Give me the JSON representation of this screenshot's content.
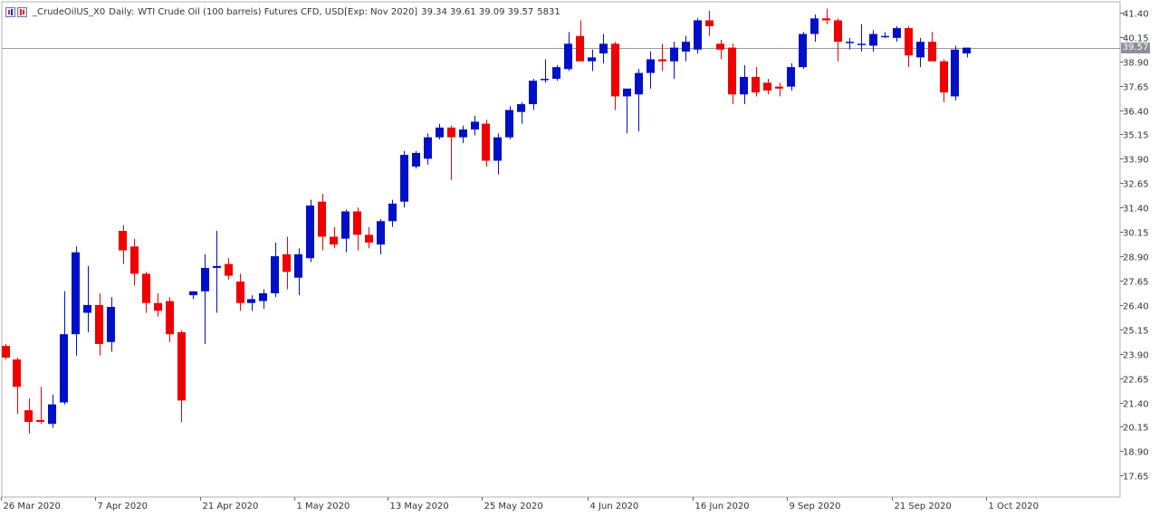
{
  "header": {
    "symbol": "_CrudeOilUS_X0",
    "timeframe": "Daily:",
    "description": "WTI Crude Oil (100 barrels) Futures CFD, USD[Exp: Nov 2020]",
    "ohlc": "39.34 39.61 39.09 39.57",
    "volume": "5831"
  },
  "current_price_label": "39.57",
  "colors": {
    "bull": "#0010C8",
    "bear": "#F00000",
    "grid": "#b0b0b0",
    "text": "#333333",
    "badge": "#8a9099"
  },
  "chart_data": {
    "type": "candlestick",
    "title": "",
    "y_ticks": [
      "41.40",
      "40.15",
      "38.90",
      "37.65",
      "36.40",
      "35.15",
      "33.90",
      "32.65",
      "31.40",
      "30.15",
      "28.90",
      "27.65",
      "26.40",
      "25.15",
      "23.90",
      "22.65",
      "21.40",
      "20.15",
      "18.90",
      "17.65"
    ],
    "x_tick_labels": [
      "26 Mar 2020",
      "7 Apr 2020",
      "21 Apr 2020",
      "1 May 2020",
      "13 May 2020",
      "25 May 2020",
      "4 Jun 2020",
      "16 Jun 2020",
      "9 Sep 2020",
      "21 Sep 2020",
      "1 Oct 2020"
    ],
    "x_tick_index": [
      0,
      8,
      17,
      25,
      33,
      41,
      50,
      59,
      67,
      76,
      84
    ],
    "ylim": [
      16.55,
      41.95
    ],
    "current_price": 39.57,
    "candles": [
      {
        "o": 24.3,
        "h": 24.4,
        "l": 23.6,
        "c": 23.7
      },
      {
        "o": 23.6,
        "h": 23.7,
        "l": 20.8,
        "c": 22.2
      },
      {
        "o": 21.0,
        "h": 21.6,
        "l": 19.8,
        "c": 20.4
      },
      {
        "o": 20.5,
        "h": 22.2,
        "l": 20.3,
        "c": 20.4
      },
      {
        "o": 20.3,
        "h": 21.8,
        "l": 20.1,
        "c": 21.3
      },
      {
        "o": 21.4,
        "h": 27.1,
        "l": 21.3,
        "c": 24.9
      },
      {
        "o": 24.9,
        "h": 29.4,
        "l": 23.8,
        "c": 29.1
      },
      {
        "o": 26.0,
        "h": 28.4,
        "l": 25.0,
        "c": 26.4
      },
      {
        "o": 26.4,
        "h": 27.0,
        "l": 23.8,
        "c": 24.4
      },
      {
        "o": 24.5,
        "h": 26.8,
        "l": 24.0,
        "c": 26.3
      },
      {
        "o": 30.2,
        "h": 30.5,
        "l": 28.5,
        "c": 29.2
      },
      {
        "o": 29.4,
        "h": 29.8,
        "l": 27.4,
        "c": 28.0
      },
      {
        "o": 28.0,
        "h": 28.1,
        "l": 26.0,
        "c": 26.5
      },
      {
        "o": 26.5,
        "h": 27.0,
        "l": 25.8,
        "c": 26.1
      },
      {
        "o": 26.6,
        "h": 26.8,
        "l": 24.5,
        "c": 24.9
      },
      {
        "o": 25.0,
        "h": 25.1,
        "l": 20.4,
        "c": 21.5
      },
      {
        "o": 26.9,
        "h": 27.1,
        "l": 26.7,
        "c": 27.1
      },
      {
        "o": 27.1,
        "h": 29.0,
        "l": 24.4,
        "c": 28.3
      },
      {
        "o": 28.3,
        "h": 30.2,
        "l": 26.0,
        "c": 28.4
      },
      {
        "o": 28.5,
        "h": 28.8,
        "l": 27.7,
        "c": 27.9
      },
      {
        "o": 27.6,
        "h": 28.0,
        "l": 26.1,
        "c": 26.5
      },
      {
        "o": 26.5,
        "h": 26.9,
        "l": 26.1,
        "c": 26.7
      },
      {
        "o": 26.6,
        "h": 27.2,
        "l": 26.2,
        "c": 27.0
      },
      {
        "o": 27.0,
        "h": 29.6,
        "l": 26.8,
        "c": 28.9
      },
      {
        "o": 29.0,
        "h": 29.9,
        "l": 27.2,
        "c": 28.1
      },
      {
        "o": 27.8,
        "h": 29.3,
        "l": 26.9,
        "c": 29.0
      },
      {
        "o": 28.8,
        "h": 31.8,
        "l": 28.6,
        "c": 31.5
      },
      {
        "o": 31.7,
        "h": 32.1,
        "l": 29.2,
        "c": 29.9
      },
      {
        "o": 29.9,
        "h": 30.4,
        "l": 29.3,
        "c": 29.5
      },
      {
        "o": 29.8,
        "h": 31.3,
        "l": 29.1,
        "c": 31.2
      },
      {
        "o": 31.2,
        "h": 31.4,
        "l": 29.2,
        "c": 30.0
      },
      {
        "o": 30.0,
        "h": 30.4,
        "l": 29.3,
        "c": 29.6
      },
      {
        "o": 29.5,
        "h": 30.8,
        "l": 29.0,
        "c": 30.7
      },
      {
        "o": 30.7,
        "h": 31.8,
        "l": 30.4,
        "c": 31.6
      },
      {
        "o": 31.7,
        "h": 34.3,
        "l": 31.4,
        "c": 34.1
      },
      {
        "o": 33.5,
        "h": 34.3,
        "l": 33.4,
        "c": 34.2
      },
      {
        "o": 33.9,
        "h": 35.2,
        "l": 33.6,
        "c": 35.0
      },
      {
        "o": 35.0,
        "h": 35.7,
        "l": 34.9,
        "c": 35.5
      },
      {
        "o": 35.5,
        "h": 35.6,
        "l": 32.8,
        "c": 35.0
      },
      {
        "o": 35.0,
        "h": 35.6,
        "l": 34.7,
        "c": 35.4
      },
      {
        "o": 35.4,
        "h": 36.1,
        "l": 35.1,
        "c": 35.8
      },
      {
        "o": 35.7,
        "h": 35.9,
        "l": 33.5,
        "c": 33.8
      },
      {
        "o": 33.8,
        "h": 35.2,
        "l": 33.1,
        "c": 35.0
      },
      {
        "o": 35.0,
        "h": 36.6,
        "l": 34.9,
        "c": 36.4
      },
      {
        "o": 36.3,
        "h": 36.8,
        "l": 35.7,
        "c": 36.7
      },
      {
        "o": 36.7,
        "h": 38.0,
        "l": 36.4,
        "c": 37.9
      },
      {
        "o": 38.0,
        "h": 39.0,
        "l": 37.8,
        "c": 38.0
      },
      {
        "o": 38.0,
        "h": 38.7,
        "l": 37.9,
        "c": 38.6
      },
      {
        "o": 38.5,
        "h": 40.4,
        "l": 38.4,
        "c": 39.8
      },
      {
        "o": 40.2,
        "h": 41.0,
        "l": 38.9,
        "c": 38.9
      },
      {
        "o": 38.9,
        "h": 39.5,
        "l": 38.4,
        "c": 39.1
      },
      {
        "o": 39.3,
        "h": 40.3,
        "l": 38.8,
        "c": 39.8
      },
      {
        "o": 39.8,
        "h": 39.9,
        "l": 36.4,
        "c": 37.1
      },
      {
        "o": 37.1,
        "h": 37.4,
        "l": 35.2,
        "c": 37.5
      },
      {
        "o": 37.2,
        "h": 38.5,
        "l": 35.3,
        "c": 38.3
      },
      {
        "o": 38.3,
        "h": 39.4,
        "l": 37.5,
        "c": 39.0
      },
      {
        "o": 39.0,
        "h": 39.8,
        "l": 38.4,
        "c": 38.9
      },
      {
        "o": 38.9,
        "h": 39.9,
        "l": 38.0,
        "c": 39.6
      },
      {
        "o": 39.4,
        "h": 40.2,
        "l": 38.9,
        "c": 39.9
      },
      {
        "o": 39.5,
        "h": 41.1,
        "l": 39.3,
        "c": 41.0
      },
      {
        "o": 41.0,
        "h": 41.5,
        "l": 40.2,
        "c": 40.7
      },
      {
        "o": 39.8,
        "h": 40.0,
        "l": 39.0,
        "c": 39.5
      },
      {
        "o": 39.6,
        "h": 39.8,
        "l": 36.7,
        "c": 37.2
      },
      {
        "o": 37.2,
        "h": 38.7,
        "l": 36.7,
        "c": 38.1
      },
      {
        "o": 38.1,
        "h": 38.6,
        "l": 37.1,
        "c": 37.3
      },
      {
        "o": 37.8,
        "h": 38.0,
        "l": 37.2,
        "c": 37.4
      },
      {
        "o": 37.6,
        "h": 37.8,
        "l": 37.1,
        "c": 37.5
      },
      {
        "o": 37.6,
        "h": 38.8,
        "l": 37.4,
        "c": 38.6
      },
      {
        "o": 38.6,
        "h": 40.4,
        "l": 38.5,
        "c": 40.3
      },
      {
        "o": 40.3,
        "h": 41.3,
        "l": 39.9,
        "c": 41.1
      },
      {
        "o": 41.1,
        "h": 41.6,
        "l": 40.8,
        "c": 41.0
      },
      {
        "o": 41.0,
        "h": 41.1,
        "l": 38.9,
        "c": 39.9
      },
      {
        "o": 39.9,
        "h": 40.1,
        "l": 39.5,
        "c": 39.9
      },
      {
        "o": 39.8,
        "h": 40.8,
        "l": 39.4,
        "c": 39.8
      },
      {
        "o": 39.7,
        "h": 40.5,
        "l": 39.4,
        "c": 40.3
      },
      {
        "o": 40.2,
        "h": 40.4,
        "l": 40.1,
        "c": 40.2
      },
      {
        "o": 40.1,
        "h": 40.7,
        "l": 39.9,
        "c": 40.6
      },
      {
        "o": 40.6,
        "h": 40.7,
        "l": 38.6,
        "c": 39.2
      },
      {
        "o": 39.1,
        "h": 40.1,
        "l": 38.6,
        "c": 39.9
      },
      {
        "o": 39.9,
        "h": 40.4,
        "l": 38.9,
        "c": 38.9
      },
      {
        "o": 38.9,
        "h": 39.0,
        "l": 36.8,
        "c": 37.3
      },
      {
        "o": 37.1,
        "h": 39.7,
        "l": 36.9,
        "c": 39.5
      },
      {
        "o": 39.3,
        "h": 39.6,
        "l": 39.1,
        "c": 39.6
      }
    ]
  }
}
